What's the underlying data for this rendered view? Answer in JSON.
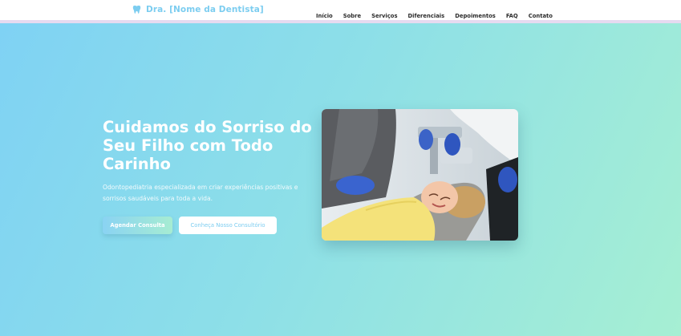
{
  "header": {
    "brand": {
      "icon": "tooth-icon",
      "name": "Dra. [Nome da Dentista]"
    },
    "nav": [
      {
        "label": "Início"
      },
      {
        "label": "Sobre"
      },
      {
        "label": "Serviços"
      },
      {
        "label": "Diferenciais"
      },
      {
        "label": "Depoimentos"
      },
      {
        "label": "FAQ"
      },
      {
        "label": "Contato"
      }
    ]
  },
  "hero": {
    "title": "Cuidamos do Sorriso do Seu Filho com Todo Carinho",
    "subtitle": "Odontopediatria especializada em criar experiências positivas e sorrisos saudáveis para toda a vida.",
    "primary_button": "Agendar Consulta",
    "secondary_button": "Conheça Nosso Consultório"
  },
  "colors": {
    "brand": "#7ccdf0",
    "hero_gradient_start": "#7fd2f4",
    "hero_gradient_end": "#a6efd3"
  }
}
